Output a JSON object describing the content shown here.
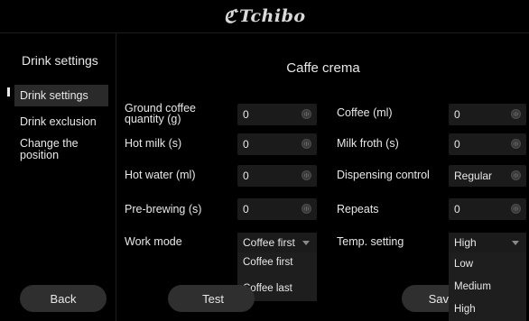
{
  "header": {
    "brand": "Tchibo",
    "logo_icon": "tchibo-coffee-bean-logo"
  },
  "sidebar": {
    "title": "Drink settings",
    "items": [
      {
        "label": "Drink settings"
      },
      {
        "label": "Drink exclusion"
      },
      {
        "label": "Change the position"
      }
    ],
    "back_label": "Back"
  },
  "main": {
    "title": "Caffe crema",
    "fields": {
      "ground_coffee": {
        "label": "Ground coffee quantity (g)",
        "value": "0"
      },
      "coffee_ml": {
        "label": "Coffee (ml)",
        "value": "0"
      },
      "hot_milk": {
        "label": "Hot milk (s)",
        "value": "0"
      },
      "milk_froth": {
        "label": "Milk froth (s)",
        "value": "0"
      },
      "hot_water": {
        "label": "Hot water (ml)",
        "value": "0"
      },
      "dispensing_control": {
        "label": "Dispensing control",
        "value": "Regular"
      },
      "pre_brewing": {
        "label": "Pre-brewing (s)",
        "value": "0"
      },
      "repeats": {
        "label": "Repeats",
        "value": "0"
      }
    },
    "work_mode": {
      "label": "Work mode",
      "selected": "Coffee first",
      "options": [
        "Coffee first",
        "Coffee last"
      ]
    },
    "temp_setting": {
      "label": "Temp. setting",
      "selected": "High",
      "options": [
        "Low",
        "Medium",
        "High"
      ]
    },
    "test_label": "Test",
    "save_label": "Sav"
  }
}
